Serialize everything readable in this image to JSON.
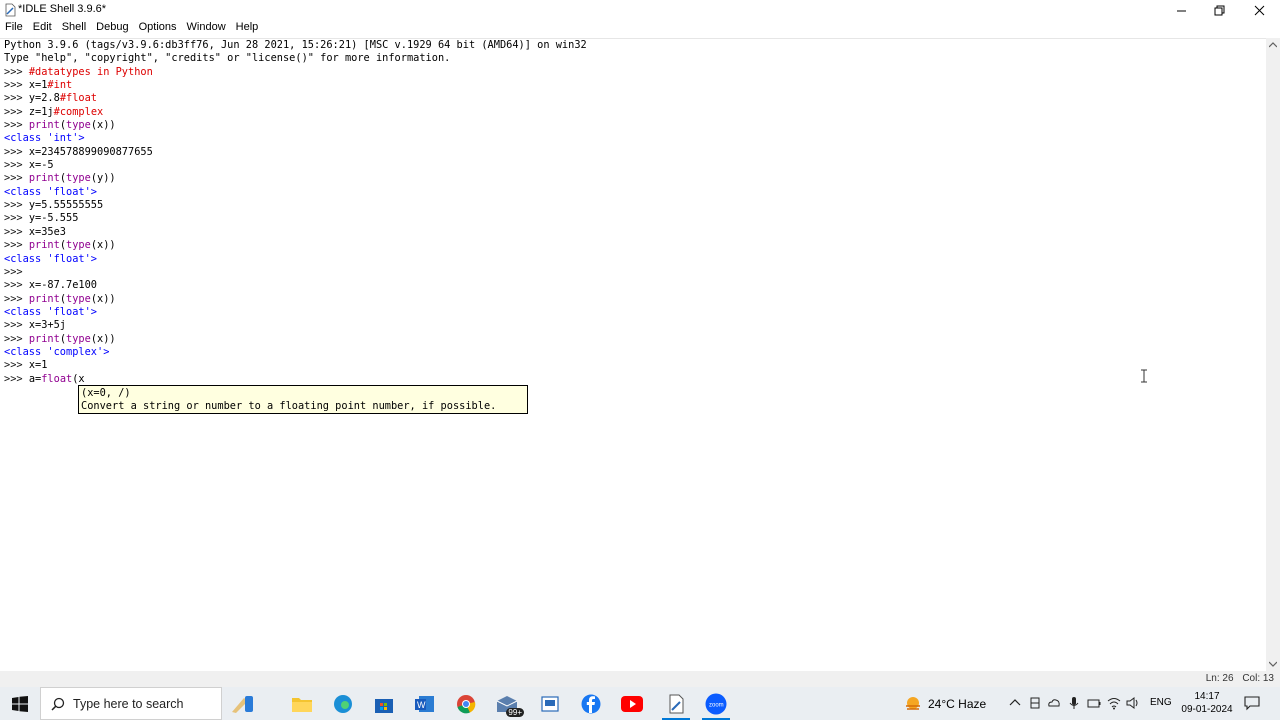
{
  "window": {
    "title": "*IDLE Shell 3.9.6*"
  },
  "menu": [
    "File",
    "Edit",
    "Shell",
    "Debug",
    "Options",
    "Window",
    "Help"
  ],
  "shell": {
    "lines": [
      {
        "kind": "plain",
        "text": "Python 3.9.6 (tags/v3.9.6:db3ff76, Jun 28 2021, 15:26:21) [MSC v.1929 64 bit (AMD64)] on win32"
      },
      {
        "kind": "plain",
        "text": "Type \"help\", \"copyright\", \"credits\" or \"license()\" for more information."
      },
      {
        "kind": "input",
        "prompt": ">>> ",
        "code": "",
        "comment": "#datatypes in Python"
      },
      {
        "kind": "input",
        "prompt": ">>> ",
        "code": "x=1",
        "comment": "#int"
      },
      {
        "kind": "input",
        "prompt": ">>> ",
        "code": "y=2.8",
        "comment": "#float"
      },
      {
        "kind": "input",
        "prompt": ">>> ",
        "code": "z=1j",
        "comment": "#complex"
      },
      {
        "kind": "call",
        "prompt": ">>> ",
        "b1": "print",
        "m1": "(",
        "b2": "type",
        "m2": "(x))"
      },
      {
        "kind": "output",
        "text": "<class 'int'>"
      },
      {
        "kind": "input",
        "prompt": ">>> ",
        "code": "x=234578899090877655",
        "comment": ""
      },
      {
        "kind": "input",
        "prompt": ">>> ",
        "code": "x=-5",
        "comment": ""
      },
      {
        "kind": "call",
        "prompt": ">>> ",
        "b1": "print",
        "m1": "(",
        "b2": "type",
        "m2": "(y))"
      },
      {
        "kind": "output",
        "text": "<class 'float'>"
      },
      {
        "kind": "input",
        "prompt": ">>> ",
        "code": "y=5.55555555",
        "comment": ""
      },
      {
        "kind": "input",
        "prompt": ">>> ",
        "code": "y=-5.555",
        "comment": ""
      },
      {
        "kind": "input",
        "prompt": ">>> ",
        "code": "x=35e3",
        "comment": ""
      },
      {
        "kind": "call",
        "prompt": ">>> ",
        "b1": "print",
        "m1": "(",
        "b2": "type",
        "m2": "(x))"
      },
      {
        "kind": "output",
        "text": "<class 'float'>"
      },
      {
        "kind": "input",
        "prompt": ">>> ",
        "code": "",
        "comment": ""
      },
      {
        "kind": "input",
        "prompt": ">>> ",
        "code": "x=-87.7e100",
        "comment": ""
      },
      {
        "kind": "call",
        "prompt": ">>> ",
        "b1": "print",
        "m1": "(",
        "b2": "type",
        "m2": "(x))"
      },
      {
        "kind": "output",
        "text": "<class 'float'>"
      },
      {
        "kind": "input",
        "prompt": ">>> ",
        "code": "x=3+5j",
        "comment": ""
      },
      {
        "kind": "call",
        "prompt": ">>> ",
        "b1": "print",
        "m1": "(",
        "b2": "type",
        "m2": "(x))"
      },
      {
        "kind": "output",
        "text": "<class 'complex'>"
      },
      {
        "kind": "input",
        "prompt": ">>> ",
        "code": "x=1",
        "comment": ""
      },
      {
        "kind": "call",
        "prompt": ">>> ",
        "b1": "",
        "m1": "a=",
        "b2": "float",
        "m2": "(x"
      }
    ]
  },
  "calltip": {
    "signature": "(x=0, /)",
    "doc": "Convert a string or number to a floating point number, if possible."
  },
  "status": {
    "line": "Ln: 26",
    "col": "Col: 13"
  },
  "taskbar": {
    "search_placeholder": "Type here to search",
    "mail_badge": "99+",
    "weather": "24°C  Haze",
    "language": "ENG",
    "time": "14:17",
    "date": "09-01-2024"
  },
  "colors": {
    "comment": "#dd0000",
    "builtin": "#900090",
    "output": "#0000ff",
    "calltip_bg": "#ffffe0",
    "taskbar_bg": "#eaeef2"
  }
}
